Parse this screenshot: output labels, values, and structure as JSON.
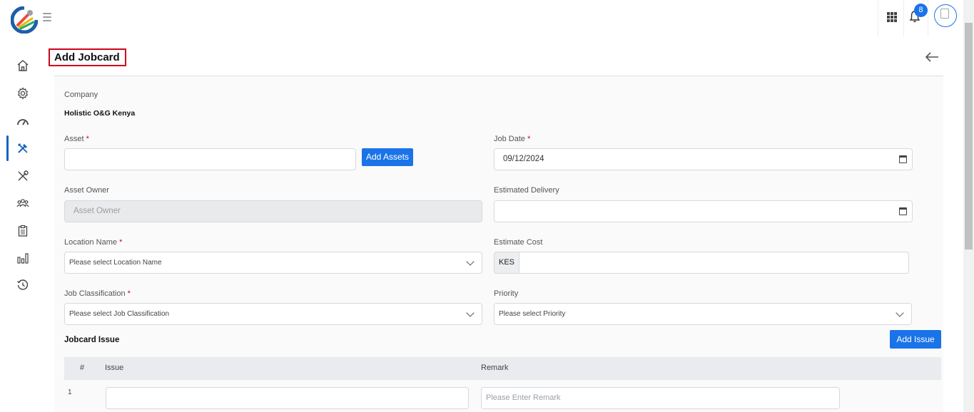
{
  "header": {
    "notification_count": "8",
    "logo_icon": "app-logo",
    "menu_icon": "hamburger-icon",
    "apps_icon": "apps-grid-icon",
    "bell_icon": "bell-icon",
    "avatar_icon": "user-avatar"
  },
  "sidebar": {
    "items": [
      {
        "icon": "home-icon"
      },
      {
        "icon": "gear-icon"
      },
      {
        "icon": "speedometer-icon"
      },
      {
        "icon": "tools-icon",
        "active": true
      },
      {
        "icon": "wrench-screwdriver-icon"
      },
      {
        "icon": "team-icon"
      },
      {
        "icon": "clipboard-icon"
      },
      {
        "icon": "bar-chart-icon"
      },
      {
        "icon": "history-icon"
      }
    ]
  },
  "page": {
    "title": "Add Jobcard",
    "back_icon": "arrow-left-icon"
  },
  "form": {
    "company_label": "Company",
    "company_value": "Holistic O&G Kenya",
    "asset_label": "Asset",
    "asset_value": "",
    "add_assets_button": "Add Assets",
    "job_date_label": "Job Date",
    "job_date_value": "09/12/2024",
    "asset_owner_label": "Asset Owner",
    "asset_owner_placeholder": "Asset Owner",
    "estimated_delivery_label": "Estimated Delivery",
    "estimated_delivery_value": "",
    "location_label": "Location Name",
    "location_placeholder": "Please select Location Name",
    "estimate_cost_label": "Estimate Cost",
    "currency": "KES",
    "job_classification_label": "Job Classification",
    "job_classification_placeholder": "Please select Job Classification",
    "priority_label": "Priority",
    "priority_placeholder": "Please select Priority",
    "required_mark": "*"
  },
  "issues": {
    "section_title": "Jobcard Issue",
    "add_issue_button": "Add Issue",
    "columns": [
      "#",
      "Issue",
      "Remark"
    ],
    "rows": [
      {
        "num": "1",
        "issue": "",
        "remark_placeholder": "Please Enter Remark"
      }
    ]
  },
  "colors": {
    "primary": "#1a73e8",
    "title_highlight": "#d0021b",
    "required": "#d0021b"
  }
}
